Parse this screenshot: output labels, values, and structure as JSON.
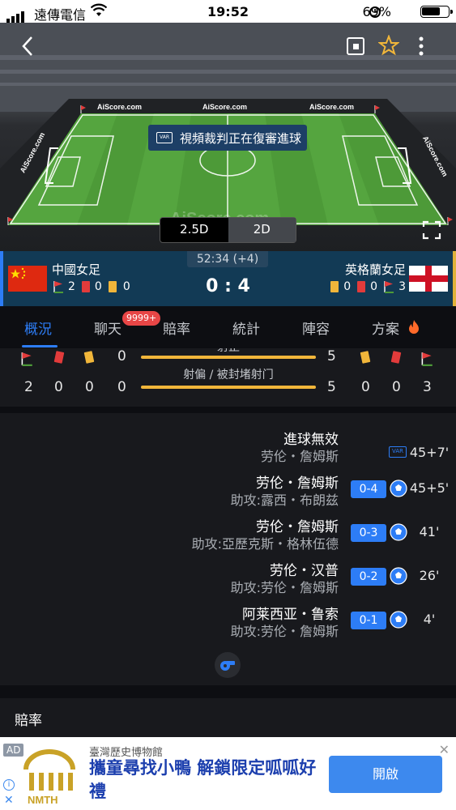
{
  "status_bar": {
    "carrier": "遠傳電信",
    "time": "19:52",
    "battery": "69%"
  },
  "stadium": {
    "ads": [
      "AiScore.com",
      "AiScore.com",
      "AiScore.com",
      "AiScore.com",
      "AiScore.com"
    ],
    "watermark": "AiScore.com",
    "var_message": "視頻裁判正在復審進球",
    "var_icon_text": "VAR",
    "view_modes": [
      "2.5D",
      "2D"
    ],
    "active_mode": "2.5D"
  },
  "match": {
    "clock": "52:34 (+4)",
    "score": "0 : 4",
    "home": {
      "name": "中國女足",
      "corners": "2",
      "red": "0",
      "yellow": "0"
    },
    "away": {
      "name": "英格蘭女足",
      "yellow": "0",
      "red": "0",
      "corners": "3"
    }
  },
  "tabs": [
    {
      "label": "概況"
    },
    {
      "label": "聊天"
    },
    {
      "label": "賠率"
    },
    {
      "label": "統計"
    },
    {
      "label": "陣容"
    },
    {
      "label": "方案"
    }
  ],
  "chat_badge": "9999+",
  "stats": {
    "row1": {
      "label": "射正",
      "home": "0",
      "away": "5"
    },
    "row2": {
      "label": "射偏 / 被封堵射门",
      "home": "0",
      "away": "5"
    },
    "home_totals": {
      "corners": "2",
      "red": "0",
      "yellow": "0"
    },
    "away_totals": {
      "yellow": "0",
      "red": "0",
      "corners": "3"
    }
  },
  "events": [
    {
      "title": "進球無效",
      "detail": "劳伦・詹姆斯",
      "minute": "45+7'",
      "type": "var"
    },
    {
      "title": "劳伦・詹姆斯",
      "detail": "助攻:露西・布朗兹",
      "score": "0-4",
      "minute": "45+5'",
      "type": "goal"
    },
    {
      "title": "劳伦・詹姆斯",
      "detail": "助攻:亞歷克斯・格林伍德",
      "score": "0-3",
      "minute": "41'",
      "type": "goal"
    },
    {
      "title": "劳伦・汉普",
      "detail": "助攻:劳伦・詹姆斯",
      "score": "0-2",
      "minute": "26'",
      "type": "goal"
    },
    {
      "title": "阿莱西亚・鲁索",
      "detail": "助攻:劳伦・詹姆斯",
      "score": "0-1",
      "minute": "4'",
      "type": "goal"
    }
  ],
  "odds_section": {
    "title": "賠率"
  },
  "ad": {
    "tag": "AD",
    "sponsor": "臺灣歷史博物館",
    "headline": "攜童尋找小鴨 解鎖限定呱呱好禮",
    "cta": "開啟",
    "logo_text": "NMTH"
  },
  "colors": {
    "accent": "#2d7df6",
    "scorebar": "#123a55",
    "pitch": "#4d9a38",
    "goal_pill": "#2d7df6"
  }
}
